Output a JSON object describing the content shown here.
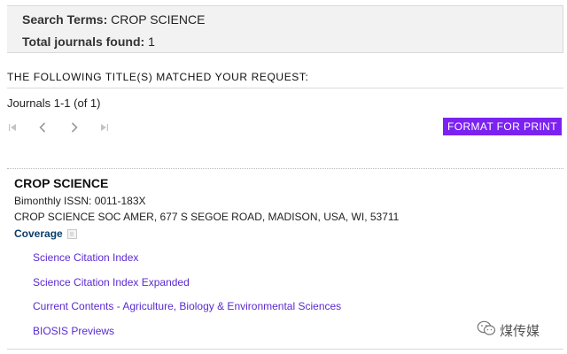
{
  "summary": {
    "search_terms_label": "Search Terms:",
    "search_terms_value": "CROP SCIENCE",
    "total_label": "Total journals found:",
    "total_value": "1"
  },
  "results": {
    "matched_heading": "THE FOLLOWING TITLE(S) MATCHED YOUR REQUEST:",
    "count_text": "Journals 1-1 (of 1)",
    "pager": {
      "first_icon": "first-page-icon",
      "prev_icon": "chevron-left-icon",
      "next_icon": "chevron-right-icon",
      "last_icon": "last-page-icon"
    },
    "print_button_label": "FORMAT FOR PRINT",
    "accent_color": "#7b22f1"
  },
  "journal": {
    "title": "CROP SCIENCE",
    "issn_line": "Bimonthly ISSN: 0011-183X",
    "publisher_line": "CROP SCIENCE SOC AMER, 677 S SEGOE ROAD, MADISON, USA, WI, 53711",
    "coverage_label": "Coverage",
    "coverage_icon": "expand-toggle-icon",
    "indexes": [
      "Science Citation Index",
      "Science Citation Index Expanded",
      "Current Contents - Agriculture, Biology & Environmental Sciences",
      "BIOSIS Previews"
    ],
    "link_color": "#5a2ad0"
  },
  "watermark": {
    "text": "煤传媒",
    "icon": "wechat-icon"
  }
}
